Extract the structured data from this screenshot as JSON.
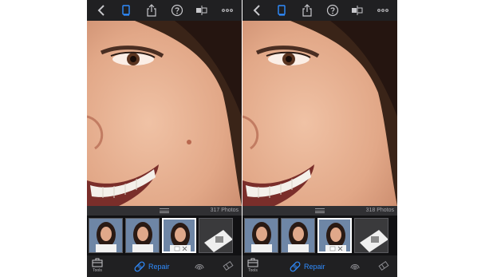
{
  "panels": [
    {
      "id": "before",
      "photo_count": "317 Photos",
      "tools_label": "Tools",
      "repair_label": "Repair"
    },
    {
      "id": "after",
      "photo_count": "318 Photos",
      "tools_label": "Tools",
      "repair_label": "Repair"
    }
  ],
  "colors": {
    "accent": "#2f8cff",
    "toolbar": "#202022",
    "icon": "#c8c8cc"
  },
  "icons": {
    "top": [
      "back-icon",
      "book-icon",
      "share-icon",
      "help-icon",
      "compare-icon",
      "more-icon"
    ],
    "bottom": [
      "toolbox-icon",
      "bandage-icon",
      "fingerprint-icon",
      "eraser-icon"
    ]
  }
}
